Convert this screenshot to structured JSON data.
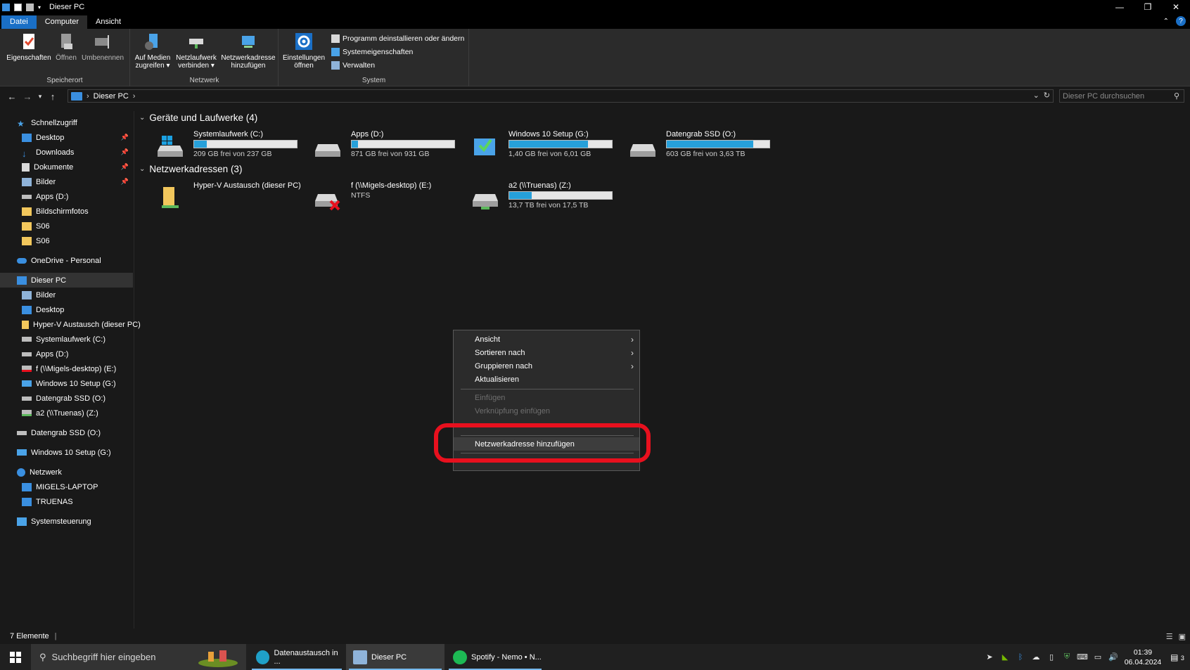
{
  "window": {
    "title": "Dieser PC",
    "controls": {
      "minimize": "—",
      "maximize": "❐",
      "close": "✕"
    }
  },
  "ribbon_tabs": {
    "file": "Datei",
    "computer": "Computer",
    "view": "Ansicht"
  },
  "ribbon": {
    "groups": {
      "location": "Speicherort",
      "network": "Netzwerk",
      "system": "System"
    },
    "buttons": {
      "properties": "Eigenschaften",
      "open": "Öffnen",
      "rename": "Umbenennen",
      "media_line1": "Auf Medien",
      "media_line2": "zugreifen ▾",
      "map_line1": "Netzlaufwerk",
      "map_line2": "verbinden ▾",
      "netloc_line1": "Netzwerkadresse",
      "netloc_line2": "hinzufügen",
      "settings_line1": "Einstellungen",
      "settings_line2": "öffnen"
    },
    "system_items": [
      "Programm deinstallieren oder ändern",
      "Systemeigenschaften",
      "Verwalten"
    ]
  },
  "address": {
    "crumb": "Dieser PC",
    "search_placeholder": "Dieser PC durchsuchen"
  },
  "nav": {
    "quick_access": "Schnellzugriff",
    "quick_items": [
      "Desktop",
      "Downloads",
      "Dokumente",
      "Bilder",
      "Apps (D:)",
      "Bildschirmfotos",
      "S06",
      "S06"
    ],
    "onedrive": "OneDrive - Personal",
    "this_pc": "Dieser PC",
    "pc_items": [
      "Bilder",
      "Desktop",
      "Hyper-V Austausch (dieser PC)",
      "Systemlaufwerk (C:)",
      "Apps (D:)",
      "f (\\\\Migels-desktop) (E:)",
      "Windows 10 Setup (G:)",
      "Datengrab SSD (O:)",
      "a2 (\\\\Truenas) (Z:)"
    ],
    "datengrab": "Datengrab SSD (O:)",
    "win10": "Windows 10 Setup (G:)",
    "network": "Netzwerk",
    "network_items": [
      "MIGELS-LAPTOP",
      "TRUENAS"
    ],
    "control_panel": "Systemsteuerung"
  },
  "content": {
    "devices_header": "Geräte und Laufwerke (4)",
    "network_header": "Netzwerkadressen (3)",
    "drives": [
      {
        "name": "Systemlaufwerk (C:)",
        "sub": "209 GB frei von 237 GB",
        "used_fraction": 0.12
      },
      {
        "name": "Apps (D:)",
        "sub": "871 GB frei von 931 GB",
        "used_fraction": 0.06
      },
      {
        "name": "Windows 10 Setup (G:)",
        "sub": "1,40 GB frei von 6,01 GB",
        "used_fraction": 0.77
      },
      {
        "name": "Datengrab SSD (O:)",
        "sub": "603 GB frei von 3,63 TB",
        "used_fraction": 0.84
      }
    ],
    "netlocs": [
      {
        "name": "Hyper-V Austausch (dieser PC)",
        "sub": ""
      },
      {
        "name": "f (\\\\Migels-desktop) (E:)",
        "sub": "NTFS"
      },
      {
        "name": "a2 (\\\\Truenas) (Z:)",
        "sub": "13,7 TB frei von 17,5 TB",
        "used_fraction": 0.22
      }
    ]
  },
  "context_menu": {
    "view": "Ansicht",
    "sort": "Sortieren nach",
    "group": "Gruppieren nach",
    "refresh": "Aktualisieren",
    "paste": "Einfügen",
    "paste_shortcut": "Verknüpfung einfügen",
    "add_network_location": "Netzwerkadresse hinzufügen"
  },
  "status": {
    "count": "7 Elemente"
  },
  "taskbar": {
    "search_placeholder": "Suchbegriff hier eingeben",
    "apps": [
      "Datenaustausch in ...",
      "Dieser PC",
      "Spotify - Nemo • N..."
    ],
    "time": "01:39",
    "date": "06.04.2024",
    "notifications": "3"
  },
  "colors": {
    "accent": "#1a6fc6",
    "drive_bar": "#26a0da",
    "highlight_ring": "#e8101e"
  }
}
